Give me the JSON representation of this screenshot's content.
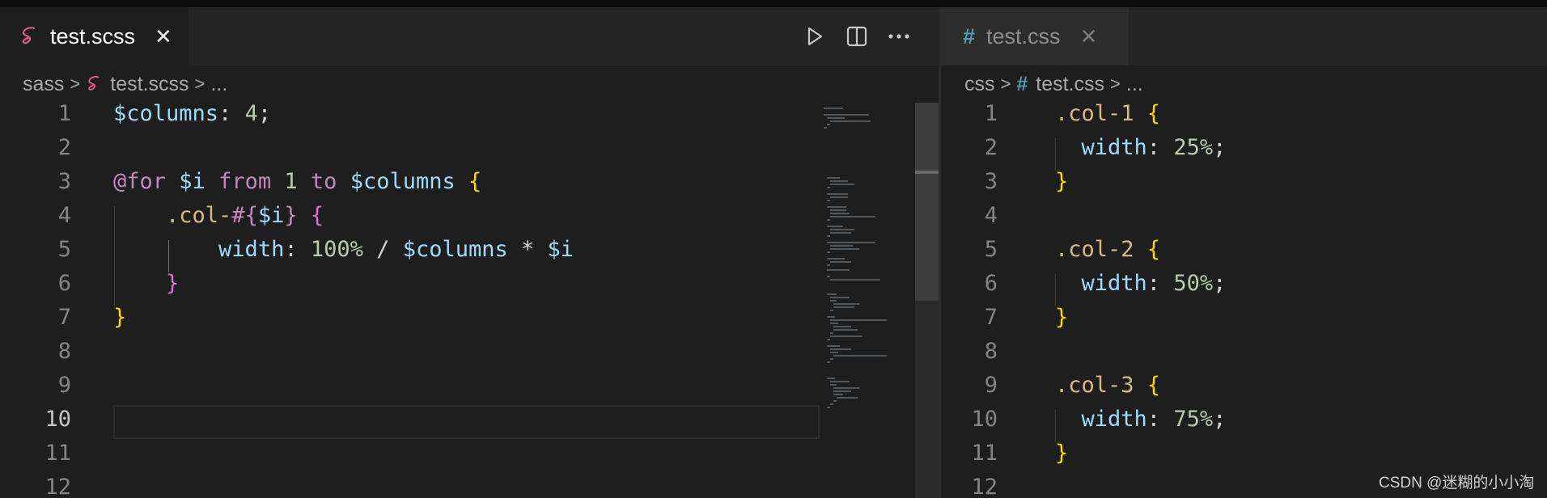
{
  "left_editor": {
    "tab": {
      "label": "test.scss",
      "icon": "sass-icon",
      "icon_color": "#e0588b",
      "close_label": "✕"
    },
    "actions": [
      "run-icon",
      "split-editor-icon",
      "more-actions-icon"
    ],
    "breadcrumb": {
      "folder": "sass",
      "file": "test.scss",
      "ellipsis": "..."
    },
    "line_numbers": [
      "1",
      "2",
      "3",
      "4",
      "5",
      "6",
      "7",
      "8",
      "9",
      "10",
      "11",
      "12"
    ],
    "active_line": "10",
    "code": {
      "l1": {
        "var": "$columns",
        "colon": ":",
        "value": "4",
        "semi": ";"
      },
      "l3": {
        "at": "@for",
        "var_i": "$i",
        "from": "from",
        "start": "1",
        "to": "to",
        "var_cols": "$columns",
        "brace": "{"
      },
      "l4": {
        "sel": ".col-",
        "interp_open": "#{",
        "var_i": "$i",
        "interp_close": "}",
        "brace": "{"
      },
      "l5": {
        "prop": "width",
        "colon": ":",
        "pct": "100%",
        "div": "/",
        "var_cols": "$columns",
        "mul": "*",
        "var_i": "$i"
      },
      "l6": {
        "brace": "}"
      },
      "l7": {
        "brace": "}"
      }
    }
  },
  "right_editor": {
    "tab": {
      "label": "test.css",
      "icon": "hash-icon",
      "icon_char": "#",
      "icon_color": "#519aba",
      "close_label": "✕"
    },
    "breadcrumb": {
      "folder": "css",
      "file": "test.css",
      "ellipsis": "..."
    },
    "line_numbers": [
      "1",
      "2",
      "3",
      "4",
      "5",
      "6",
      "7",
      "8",
      "9",
      "10",
      "11",
      "12"
    ],
    "rules": [
      {
        "selector": ".col-1",
        "open": "{",
        "prop": "width",
        "colon": ":",
        "value": "25%",
        "semi": ";",
        "close": "}"
      },
      {
        "selector": ".col-2",
        "open": "{",
        "prop": "width",
        "colon": ":",
        "value": "50%",
        "semi": ";",
        "close": "}"
      },
      {
        "selector": ".col-3",
        "open": "{",
        "prop": "width",
        "colon": ":",
        "value": "75%",
        "semi": ";",
        "close": "}"
      }
    ]
  },
  "watermark": "CSDN @迷糊的小小淘"
}
